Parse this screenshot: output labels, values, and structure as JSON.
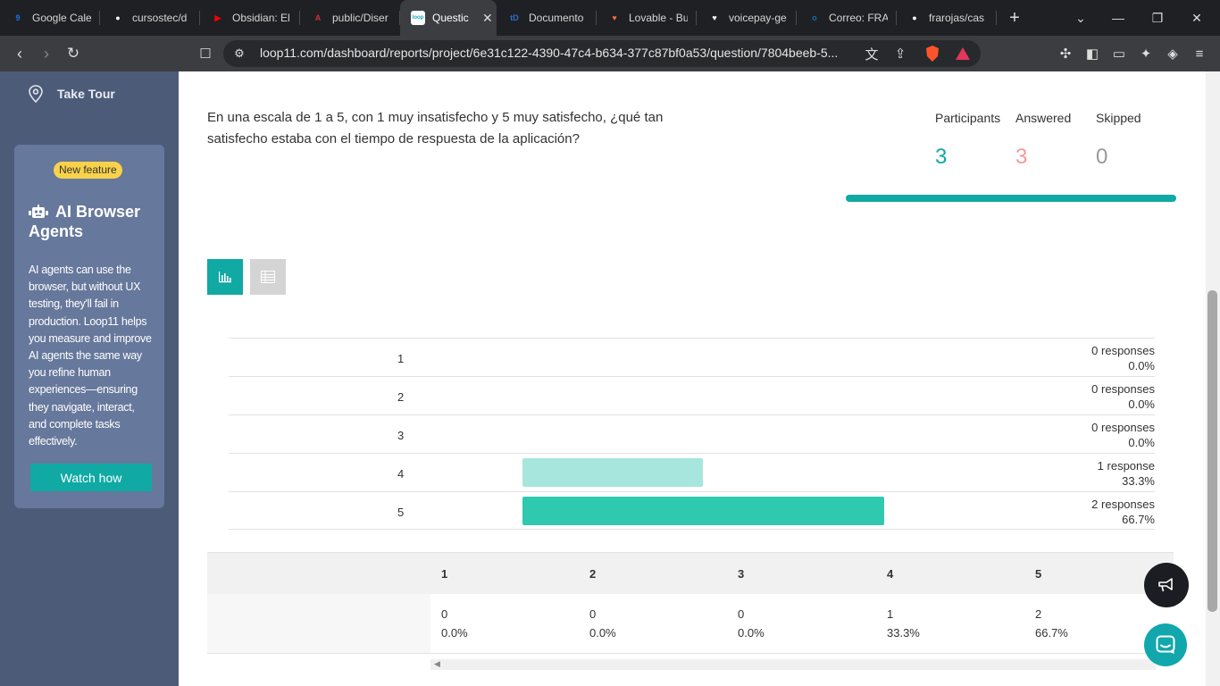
{
  "browser": {
    "tabs": [
      {
        "label": "Google Cale",
        "icon": "google-calendar-icon",
        "color": "#1a73e8",
        "glyph": "9"
      },
      {
        "label": "cursostec/d",
        "icon": "github-icon",
        "color": "#ffffff",
        "glyph": "●"
      },
      {
        "label": "Obsidian: El",
        "icon": "youtube-icon",
        "color": "#ff0000",
        "glyph": "▶"
      },
      {
        "label": "public/Diser",
        "icon": "pdf-icon",
        "color": "#d32f2f",
        "glyph": "A"
      },
      {
        "label": "Questic",
        "icon": "loop11-icon",
        "color": "#18a7b5",
        "glyph": "loop",
        "active": true
      },
      {
        "label": "Documento",
        "icon": "documento-icon",
        "color": "#2b6fd6",
        "glyph": "tD"
      },
      {
        "label": "Lovable - Bu",
        "icon": "lovable-icon",
        "color": "#f06a3a",
        "glyph": "♥"
      },
      {
        "label": "voicepay-ge",
        "icon": "heart-icon",
        "color": "#ffffff",
        "glyph": "♥"
      },
      {
        "label": "Correo: FRA",
        "icon": "outlook-icon",
        "color": "#0f6cbd",
        "glyph": "o"
      },
      {
        "label": "frarojas/cas",
        "icon": "github-icon",
        "color": "#ffffff",
        "glyph": "●"
      }
    ],
    "url": "loop11.com/dashboard/reports/project/6e31c122-4390-47c4-b634-377c87bf0a53/question/7804beeb-5..."
  },
  "sidebar": {
    "take_tour": "Take Tour",
    "badge": "New feature",
    "promo_title": "AI Browser Agents",
    "promo_text": "AI agents can use the browser, but without UX testing, they'll fail in production. Loop11 helps you measure and improve AI agents the same way you refine human experiences—ensuring they navigate, interact, and complete tasks effectively.",
    "cta": "Watch how"
  },
  "question": {
    "text": "En una escala de 1 a 5, con 1 muy insatisfecho y 5 muy satisfecho, ¿qué tan satisfecho estaba con el tiempo de respuesta de la aplicación?"
  },
  "stats": {
    "participants_label": "Participants",
    "participants_value": "3",
    "answered_label": "Answered",
    "answered_value": "3",
    "skipped_label": "Skipped",
    "skipped_value": "0",
    "answered_fraction": 1.0
  },
  "colors": {
    "accent": "#10a9a4",
    "participants": "#10a9a4",
    "answered": "#f29a9a",
    "skipped": "#999999",
    "bar_light": "#a6e6dc",
    "bar_dark": "#2fc9b0"
  },
  "chart_data": {
    "type": "bar",
    "categories": [
      "1",
      "2",
      "3",
      "4",
      "5"
    ],
    "values": [
      0,
      0,
      0,
      1,
      2
    ],
    "responses_text": [
      "0 responses",
      "0 responses",
      "0 responses",
      "1 response",
      "2 responses"
    ],
    "percent_text": [
      "0.0%",
      "0.0%",
      "0.0%",
      "33.3%",
      "66.7%"
    ],
    "percent": [
      0.0,
      0.0,
      0.0,
      33.3,
      66.7
    ]
  },
  "table": {
    "headers": [
      "1",
      "2",
      "3",
      "4",
      "5"
    ],
    "counts": [
      "0",
      "0",
      "0",
      "1",
      "2"
    ],
    "percents": [
      "0.0%",
      "0.0%",
      "0.0%",
      "33.3%",
      "66.7%"
    ]
  }
}
